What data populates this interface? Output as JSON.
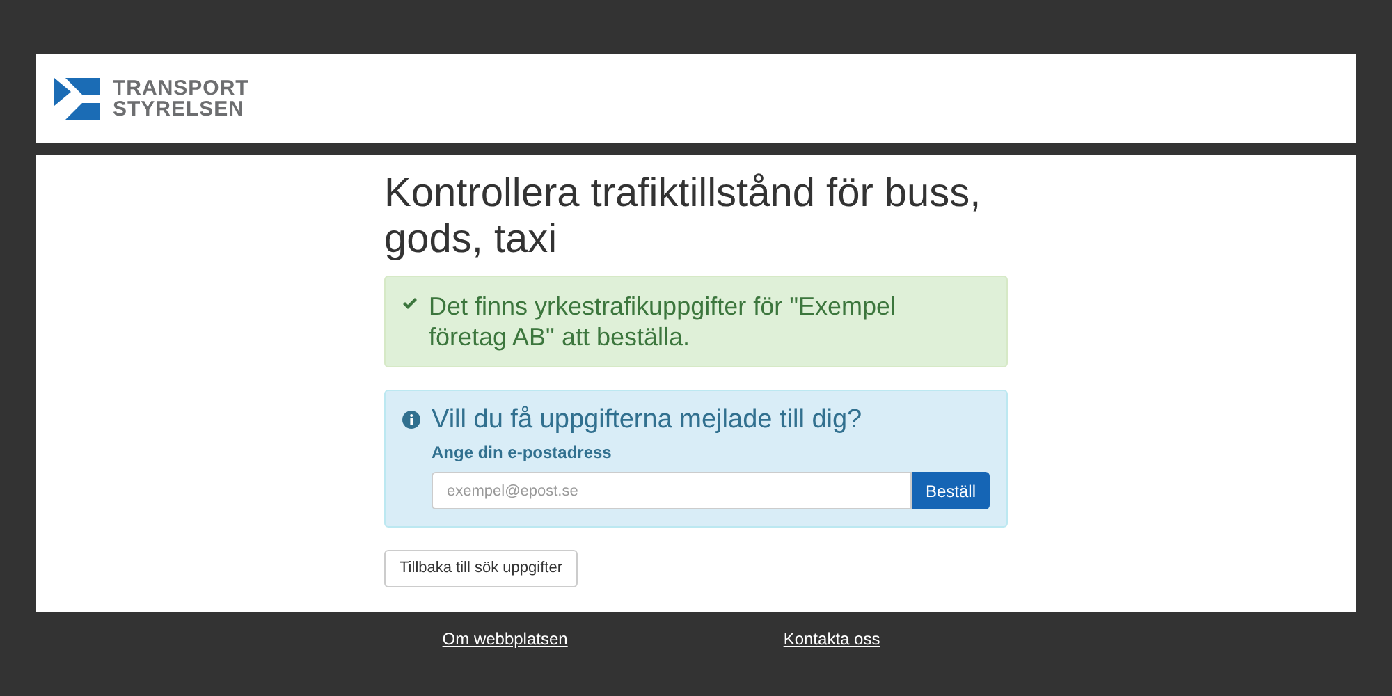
{
  "header": {
    "logo_lines": [
      "TRANSPORT",
      "STYRELSEN"
    ]
  },
  "page": {
    "title": "Kontrollera trafiktillstånd för buss, gods, taxi",
    "success_alert": {
      "text": "Det finns yrkestrafikuppgifter för \"Exempel företag AB\" att beställa."
    },
    "email_panel": {
      "heading": "Vill du få uppgifterna mejlade till dig?",
      "label": "Ange din e-postadress",
      "placeholder": "exempel@epost.se",
      "button": "Beställ"
    },
    "back_button": "Tillbaka till sök uppgifter"
  },
  "footer": {
    "links": [
      "Om webbplatsen",
      "Kontakta oss"
    ]
  }
}
